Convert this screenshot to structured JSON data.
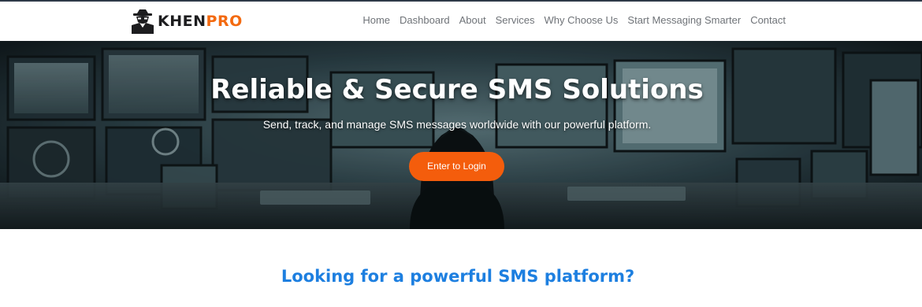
{
  "brand": {
    "name_part1": "KHEN",
    "name_part2": "PRO",
    "colors": {
      "dark": "#1d1d1f",
      "accent": "#f36a10"
    },
    "icon": "hooded-hacker-logo-icon"
  },
  "nav": {
    "items": [
      {
        "label": "Home"
      },
      {
        "label": "Dashboard"
      },
      {
        "label": "About"
      },
      {
        "label": "Services"
      },
      {
        "label": "Why Choose Us"
      },
      {
        "label": "Start Messaging Smarter"
      },
      {
        "label": "Contact"
      }
    ]
  },
  "hero": {
    "title": "Reliable & Secure SMS Solutions",
    "subtitle": "Send, track, and manage SMS messages worldwide with our powerful platform.",
    "cta_label": "Enter to Login",
    "cta_color": "#f45d0c"
  },
  "section": {
    "heading": "Looking for a powerful SMS platform?",
    "heading_color": "#1d7fe0"
  }
}
